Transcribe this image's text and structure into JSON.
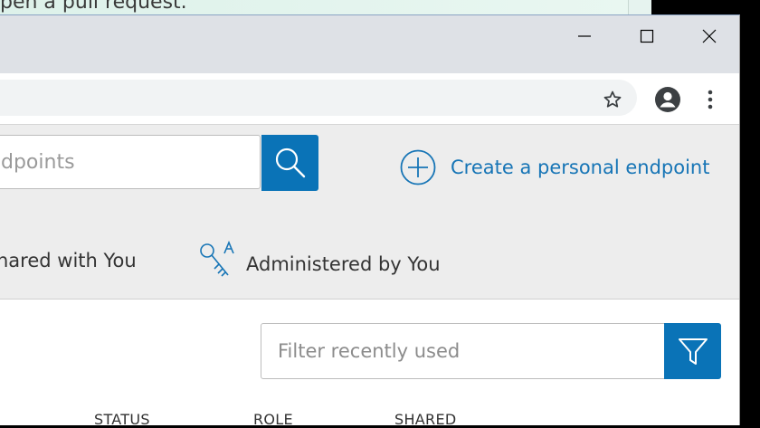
{
  "background_window": {
    "text": "pen a pull request."
  },
  "window_controls": {
    "minimize_icon": "minimize-icon",
    "maximize_icon": "maximize-icon",
    "close_icon": "close-icon"
  },
  "toolbar": {
    "bookmark_icon": "star-icon",
    "profile_icon": "account-icon",
    "menu_icon": "more-vert-icon"
  },
  "search": {
    "placeholder": "dpoints",
    "button_icon": "search-icon"
  },
  "create_link": {
    "label": "Create a personal endpoint",
    "icon": "plus-circle-icon"
  },
  "tabs": [
    {
      "label": "hared with You"
    },
    {
      "label": "Administered by You",
      "icon": "keys-icon"
    }
  ],
  "filter": {
    "placeholder": "Filter recently used",
    "button_icon": "filter-icon"
  },
  "columns": [
    "STATUS",
    "ROLE",
    "SHARED"
  ],
  "colors": {
    "accent": "#0a73b7",
    "link": "#1775b6",
    "titlebar": "#dee1e6"
  }
}
